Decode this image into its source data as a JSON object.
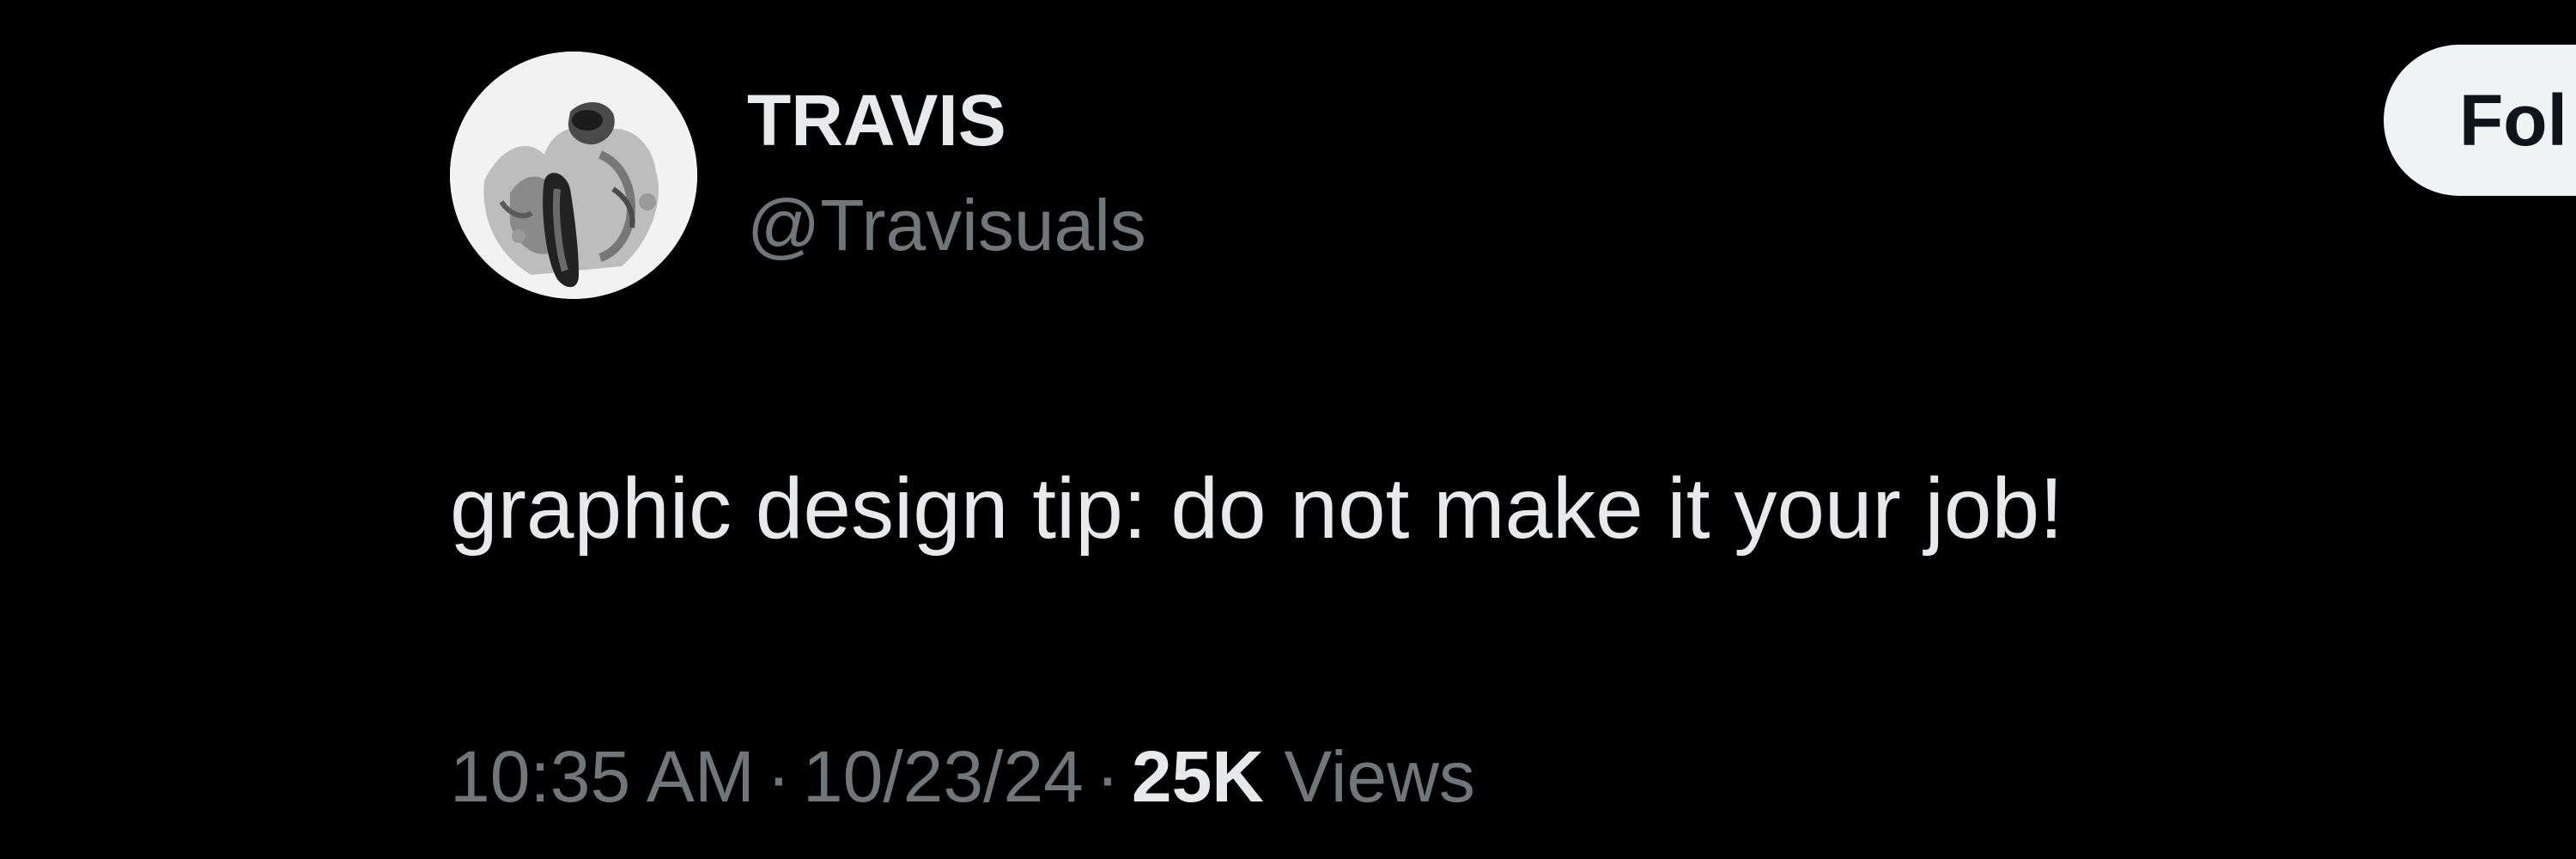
{
  "author": {
    "display_name": "TRAVIS",
    "handle": "@Travisuals",
    "avatar_icon": "monochrome-figure-avatar-icon"
  },
  "follow_button": {
    "label": "Fol"
  },
  "tweet": {
    "text": "graphic design tip: do not make it your job!"
  },
  "meta": {
    "time": "10:35 AM",
    "separator": "·",
    "date": "10/23/24",
    "views_count": "25K",
    "views_label": "Views"
  },
  "colors": {
    "background": "#000000",
    "primary_text": "#e7e9ea",
    "secondary_text": "#71767b",
    "follow_button_bg": "#eff3f4"
  }
}
